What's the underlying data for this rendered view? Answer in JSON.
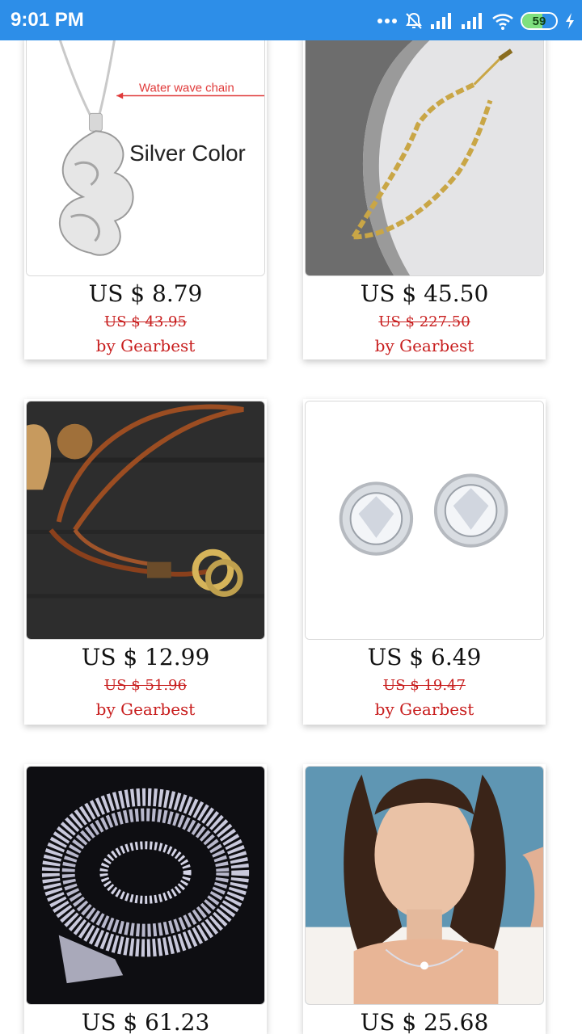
{
  "status_bar": {
    "time": "9:01 PM",
    "battery_level": "59",
    "battery_fraction": 0.59
  },
  "products": [
    {
      "image_caption_1": "Water wave chain",
      "image_caption_2": "Silver Color",
      "price": "US $ 8.79",
      "old_price": "US $ 43.95",
      "seller": "by Gearbest"
    },
    {
      "price": "US $ 45.50",
      "old_price": "US $ 227.50",
      "seller": "by Gearbest"
    },
    {
      "price": "US $ 12.99",
      "old_price": "US $ 51.96",
      "seller": "by Gearbest"
    },
    {
      "price": "US $ 6.49",
      "old_price": "US $ 19.47",
      "seller": "by Gearbest"
    },
    {
      "price": "US $ 61.23",
      "old_price": "",
      "seller": ""
    },
    {
      "price": "US $ 25.68",
      "old_price": "",
      "seller": ""
    }
  ],
  "colors": {
    "status_bar": "#2d8ee8",
    "accent_red": "#c81e1e"
  }
}
